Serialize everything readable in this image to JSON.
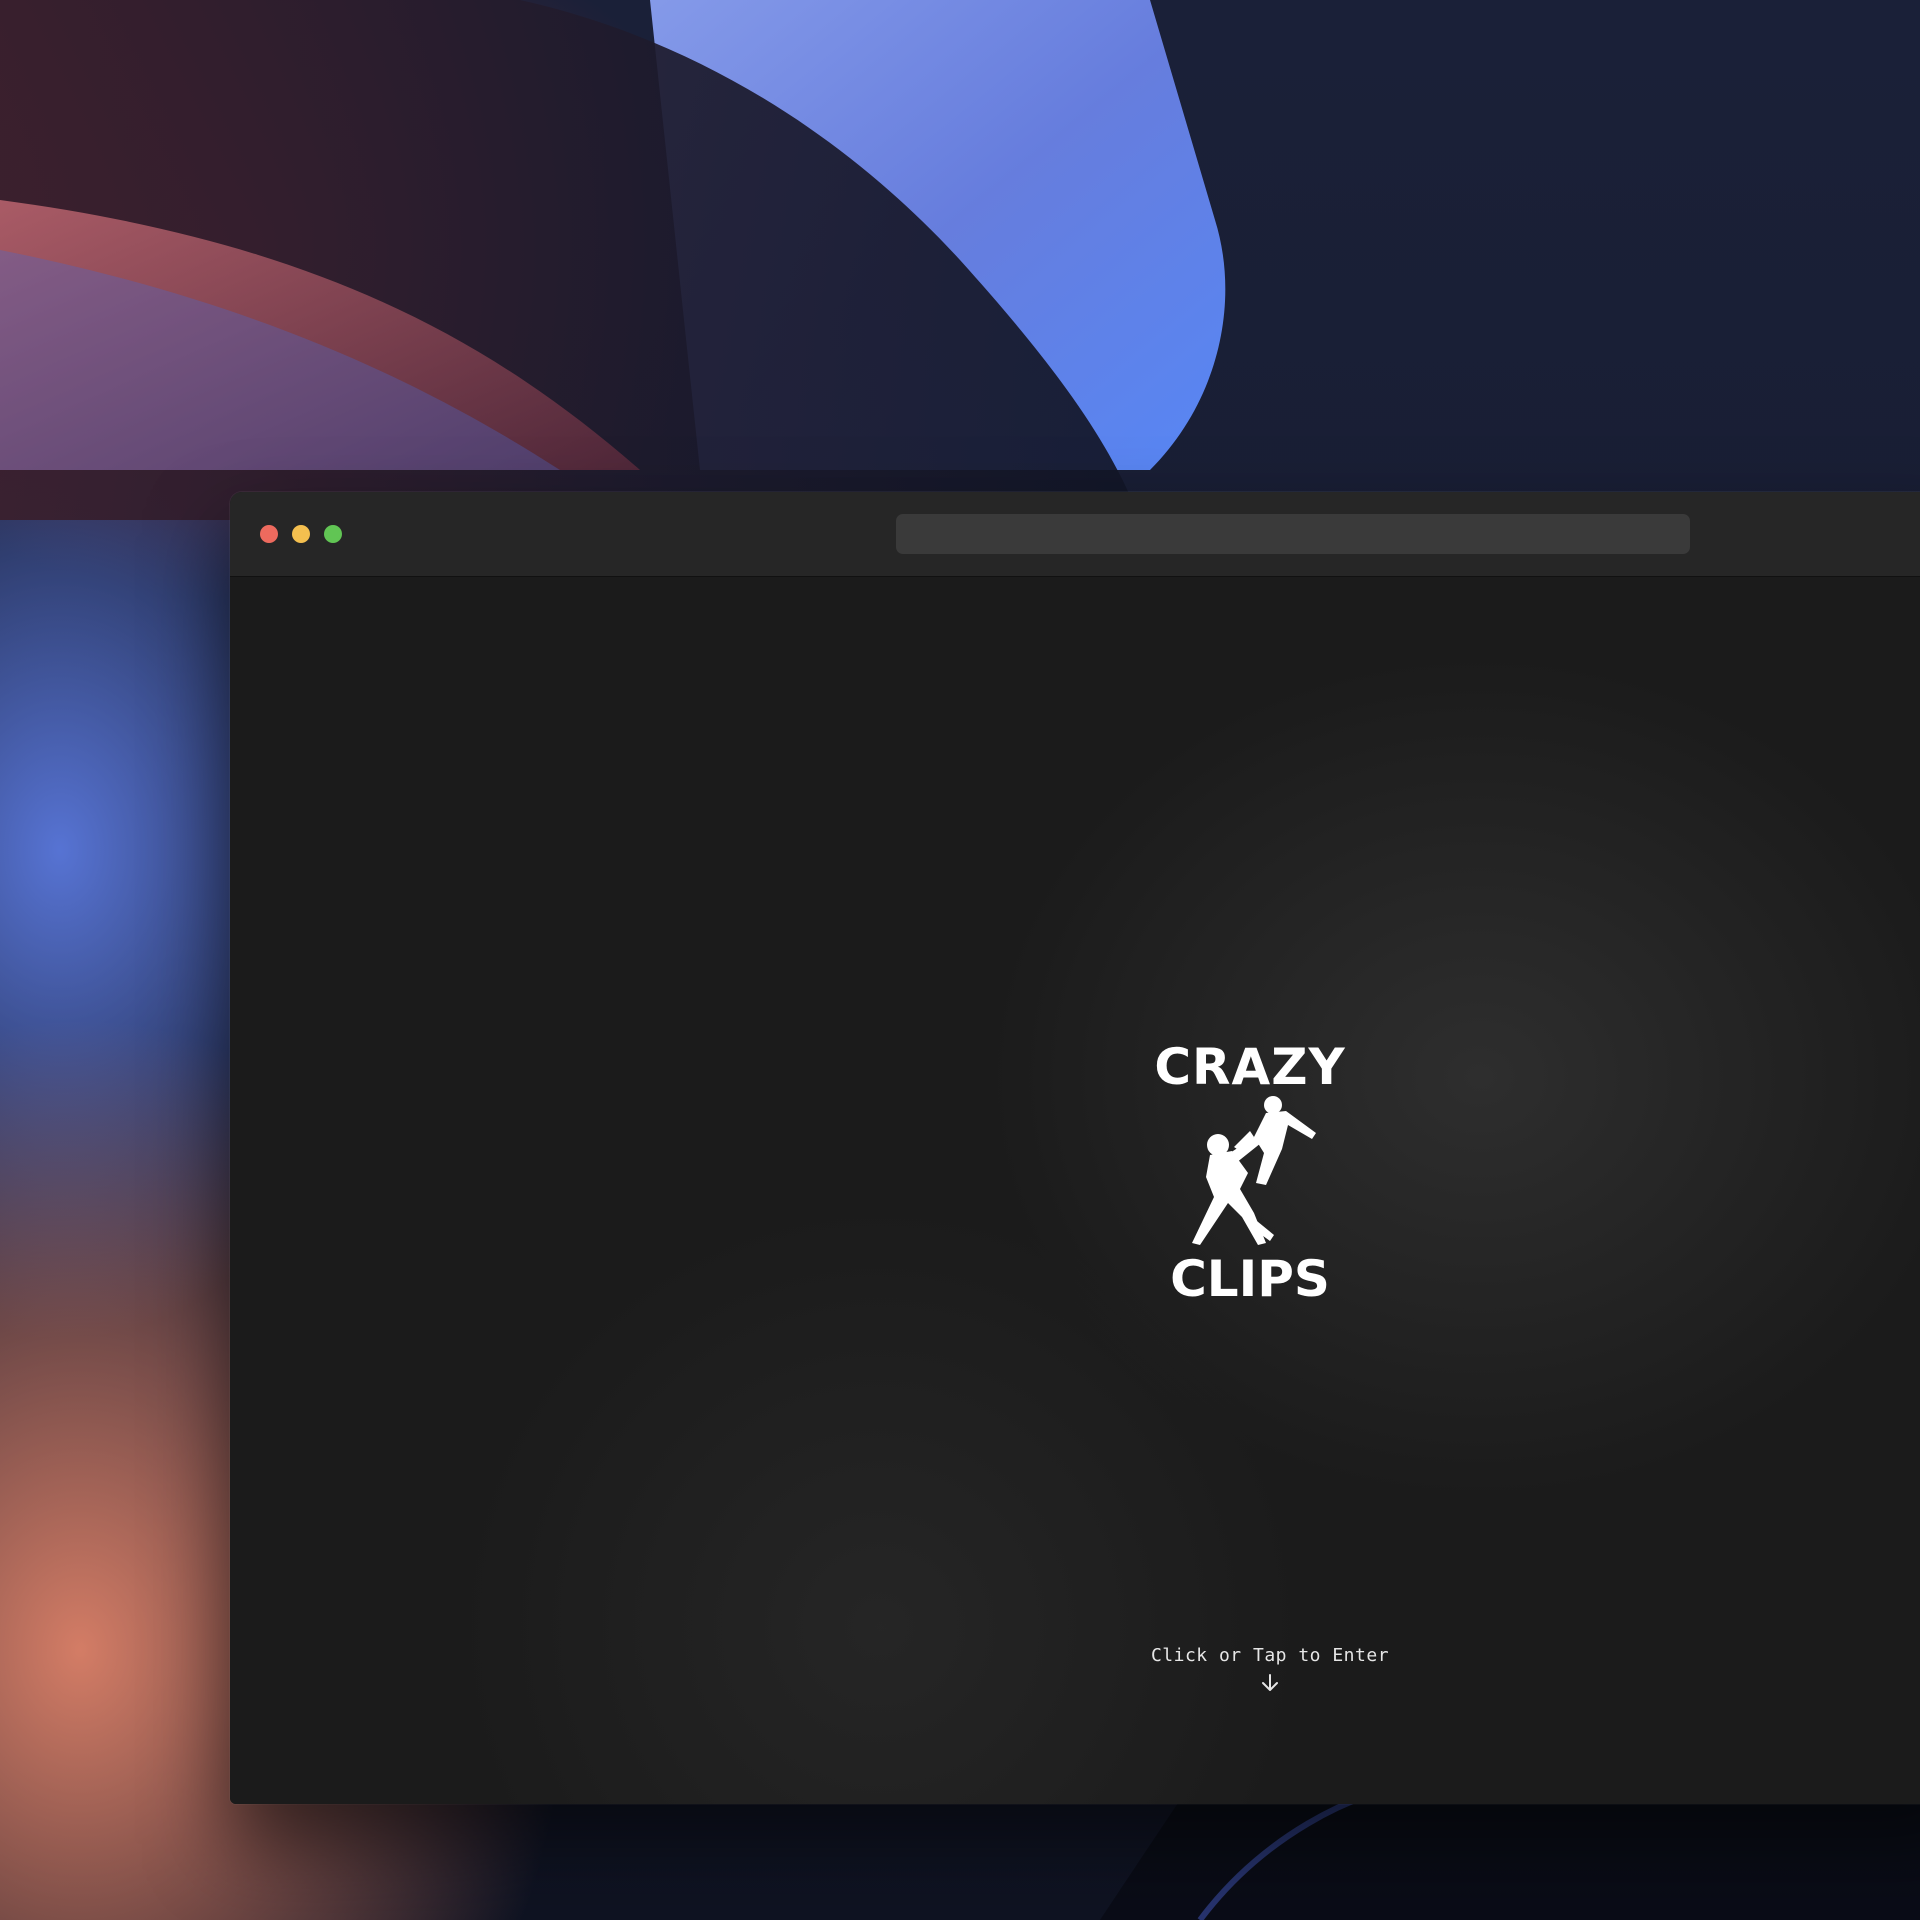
{
  "browser": {
    "address_bar_value": ""
  },
  "page": {
    "logo_top": "CRAZY",
    "logo_bottom": "CLIPS",
    "enter_label": "Click or Tap to Enter",
    "enter_icon": "arrow-down-icon"
  },
  "colors": {
    "page_background": "#1b1b1b",
    "titlebar": "#262626",
    "traffic_close": "#ed6a5e",
    "traffic_minimize": "#f4bf4f",
    "traffic_maximize": "#61c554"
  }
}
